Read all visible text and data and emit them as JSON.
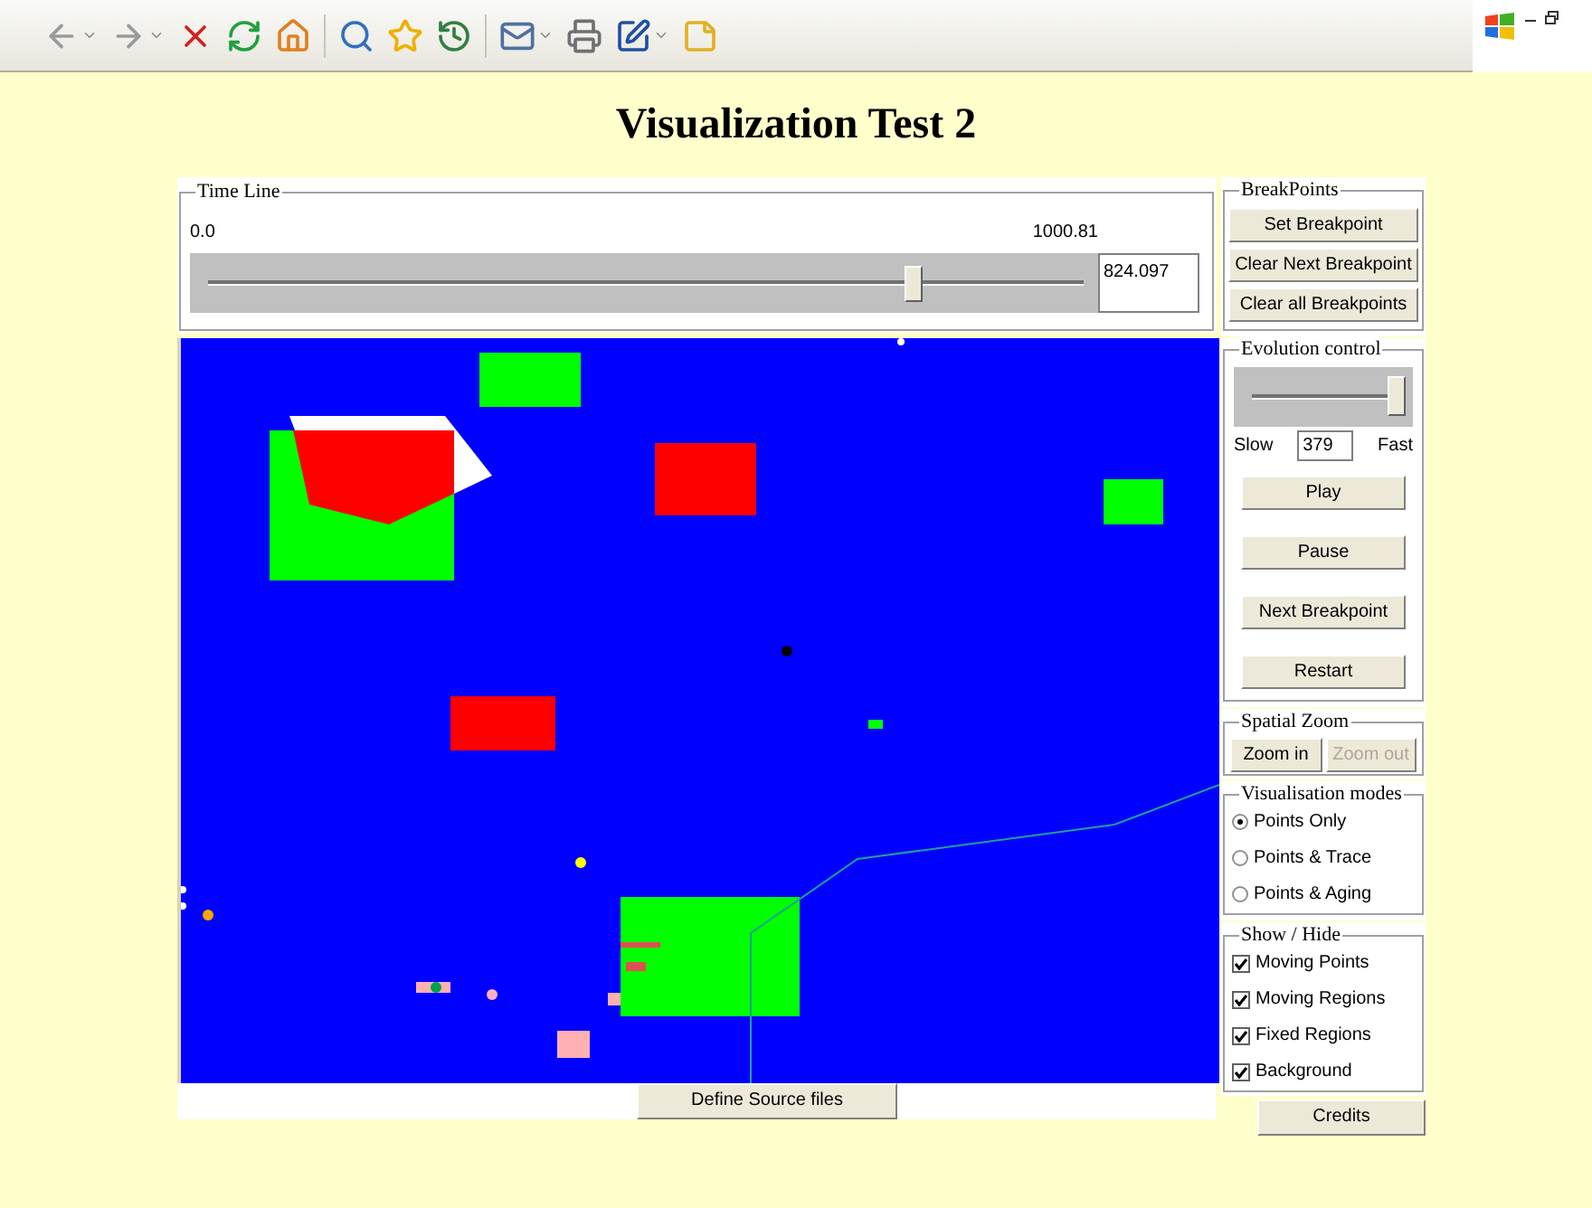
{
  "title": "Visualization Test 2",
  "timeline": {
    "legend": "Time Line",
    "min_label": "0.0",
    "max_label": "1000.81",
    "level": 0.82,
    "value": "824.097"
  },
  "breakpoints": {
    "legend": "BreakPoints",
    "buttons": [
      "Set Breakpoint",
      "Clear Next Breakpoint",
      "Clear all Breakpoints"
    ]
  },
  "evolution": {
    "legend": "Evolution control",
    "level": 0.97,
    "slow_label": "Slow",
    "speed": "379",
    "fast_label": "Fast",
    "buttons": [
      "Play",
      "Pause",
      "Next Breakpoint",
      "Restart"
    ]
  },
  "spatial_zoom": {
    "legend": "Spatial Zoom",
    "buttons": [
      {
        "label": "Zoom in",
        "disabled": false
      },
      {
        "label": "Zoom out",
        "disabled": true
      }
    ]
  },
  "visualisation_modes": {
    "legend": "Visualisation modes",
    "options": [
      {
        "label": "Points Only",
        "selected": true
      },
      {
        "label": "Points & Trace",
        "selected": false
      },
      {
        "label": "Points & Aging",
        "selected": false
      }
    ]
  },
  "show_hide": {
    "legend": "Show / Hide",
    "items": [
      {
        "label": "Moving Points",
        "checked": true
      },
      {
        "label": "Moving Regions",
        "checked": true
      },
      {
        "label": "Fixed Regions",
        "checked": true
      },
      {
        "label": "Background",
        "checked": true
      }
    ]
  },
  "bottom_buttons": [
    "Define Source files",
    "Credits"
  ]
}
